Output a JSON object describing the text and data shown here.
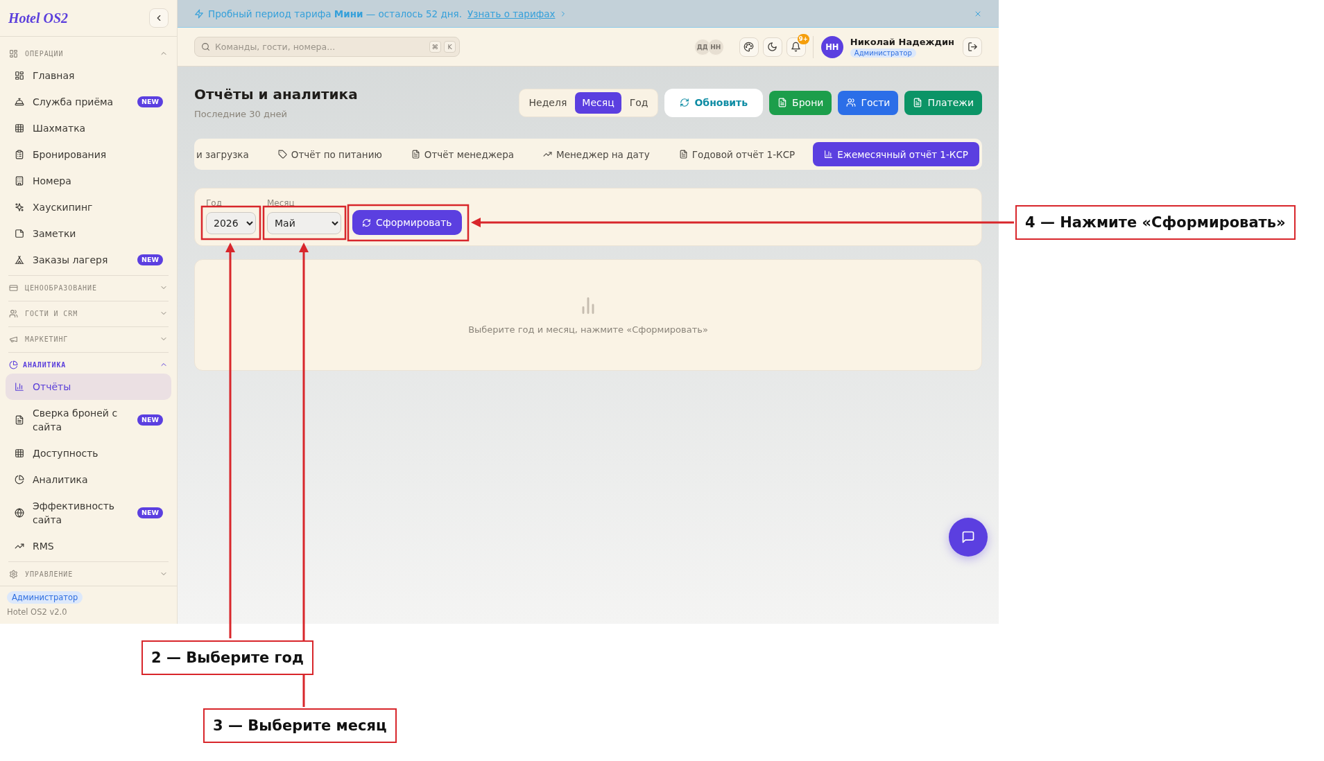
{
  "sidebar": {
    "logo": "Hotel OS2",
    "sections": [
      {
        "title": "ОПЕРАЦИИ",
        "expanded": true,
        "items": [
          {
            "label": "Главная",
            "selected": false
          },
          {
            "label": "Служба приёма",
            "selected": false,
            "badge": "NEW"
          },
          {
            "label": "Шахматка",
            "selected": false
          },
          {
            "label": "Бронирования",
            "selected": false
          },
          {
            "label": "Номера",
            "selected": false
          },
          {
            "label": "Хаускипинг",
            "selected": false
          },
          {
            "label": "Заметки",
            "selected": false
          },
          {
            "label": "Заказы лагеря",
            "selected": false,
            "badge": "NEW"
          }
        ]
      },
      {
        "title": "ЦЕНООБРАЗОВАНИЕ",
        "expanded": false
      },
      {
        "title": "ГОСТИ И CRM",
        "expanded": false
      },
      {
        "title": "МАРКЕТИНГ",
        "expanded": false
      },
      {
        "title": "АНАЛИТИКА",
        "expanded": true,
        "items": [
          {
            "label": "Отчёты",
            "selected": true
          },
          {
            "label": "Сверка броней с сайта",
            "selected": false,
            "badge": "NEW"
          },
          {
            "label": "Доступность",
            "selected": false
          },
          {
            "label": "Аналитика",
            "selected": false
          },
          {
            "label": "Эффективность сайта",
            "selected": false,
            "badge": "NEW"
          },
          {
            "label": "RMS",
            "selected": false
          }
        ]
      },
      {
        "title": "УПРАВЛЕНИЕ",
        "expanded": false
      }
    ],
    "footer": {
      "role": "Администратор",
      "version": "Hotel OS2 v2.0"
    }
  },
  "banner": {
    "message": "Пробный период тарифа **Мини** — осталось 52 дня.",
    "link": "Узнать о тарифах"
  },
  "topbar": {
    "search": {
      "placeholder": "Команды, гости, номера...",
      "keys": [
        "⌘",
        "K"
      ]
    },
    "presence": [
      "ДД",
      "НН"
    ],
    "notifications": "9+",
    "user": {
      "initials": "НН",
      "name": "Николай Надеждин",
      "role": "Администратор"
    }
  },
  "page": {
    "title": "Отчёты и аналитика",
    "subtitle": "Последние 30 дней",
    "periods": [
      {
        "label": "Неделя",
        "selected": false
      },
      {
        "label": "Месяц",
        "selected": true
      },
      {
        "label": "Год",
        "selected": false
      }
    ],
    "actions": [
      {
        "label": "Обновить",
        "kind": "outline",
        "color": "#0e8ca4"
      },
      {
        "label": "Брони",
        "kind": "solid",
        "color": "#1c9e4b"
      },
      {
        "label": "Гости",
        "kind": "solid",
        "color": "#2b6ee8"
      },
      {
        "label": "Платежи",
        "kind": "solid",
        "color": "#0b9466"
      }
    ],
    "tabs": [
      {
        "label": "и загрузка",
        "selected": false
      },
      {
        "label": "Отчёт по питанию",
        "selected": false
      },
      {
        "label": "Отчёт менеджера",
        "selected": false
      },
      {
        "label": "Менеджер на дату",
        "selected": false
      },
      {
        "label": "Годовой отчёт 1-КСР",
        "selected": false
      },
      {
        "label": "Ежемесячный отчёт 1-КСР",
        "selected": true
      }
    ],
    "form": {
      "fields": [
        {
          "label": "Год",
          "value": "2026"
        },
        {
          "label": "Месяц",
          "value": "Май"
        }
      ],
      "submit": "Сформировать"
    },
    "empty_state": "Выберите год и месяц, нажмите «Сформировать»"
  },
  "callouts": [
    "2 — Выберите год",
    "3 — Выберите месяц",
    "4 — Нажмите «Сформировать»"
  ]
}
